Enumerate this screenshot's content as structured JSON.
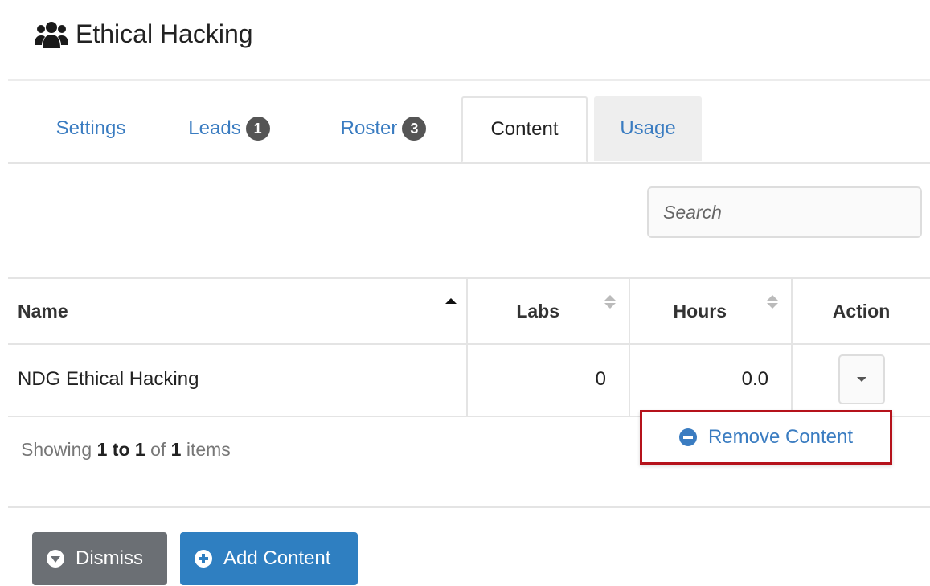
{
  "header": {
    "icon": "users-group-icon",
    "title": "Ethical Hacking"
  },
  "tabs": [
    {
      "label": "Settings",
      "badge": null,
      "state": "link"
    },
    {
      "label": "Leads",
      "badge": "1",
      "state": "link"
    },
    {
      "label": "Roster",
      "badge": "3",
      "state": "link"
    },
    {
      "label": "Content",
      "badge": null,
      "state": "active"
    },
    {
      "label": "Usage",
      "badge": null,
      "state": "inactive-grey"
    }
  ],
  "search": {
    "placeholder": "Search",
    "value": ""
  },
  "table": {
    "columns": [
      "Name",
      "Labs",
      "Hours",
      "Action"
    ],
    "rows": [
      {
        "name": "NDG Ethical Hacking",
        "labs": "0",
        "hours": "0.0"
      }
    ]
  },
  "dropdown": {
    "item": "Remove Content",
    "icon": "minus-circle-icon",
    "highlight_color": "#b5121b"
  },
  "pagination": {
    "prefix": "Showing",
    "range": "1 to 1",
    "of": "of",
    "total": "1",
    "suffix": "items"
  },
  "buttons": {
    "dismiss": "Dismiss",
    "add_content": "Add Content"
  },
  "colors": {
    "link": "#3a7cc1",
    "primary_button": "#2f7fc1",
    "secondary_button": "#6b6f74",
    "badge": "#555555"
  }
}
